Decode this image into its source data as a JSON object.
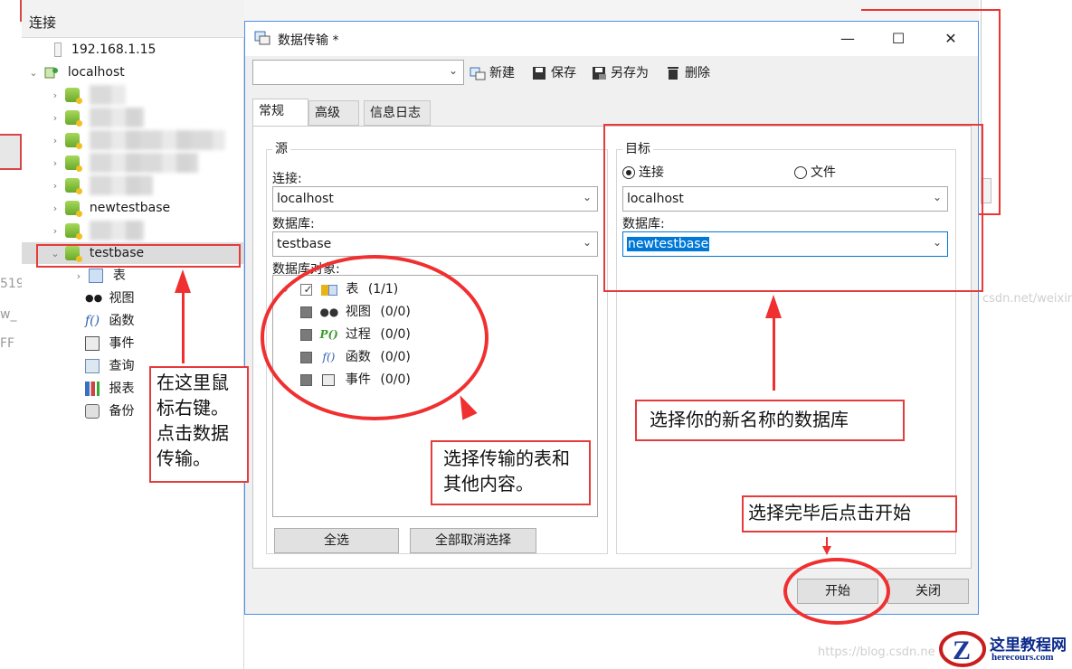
{
  "background": {
    "left_fragments": [
      "519",
      "w_",
      "FF"
    ],
    "watermark_right": "csdn.net/weixin",
    "watermark_bottom": "https://blog.csdn.ne"
  },
  "connection_panel": {
    "header": "连接",
    "tree": {
      "ip_item": "192.168.1.15",
      "localhost": "localhost",
      "newtestbase": "newtestbase",
      "testbase": "testbase",
      "children": [
        "表",
        "视图",
        "函数",
        "事件",
        "查询",
        "报表",
        "备份"
      ]
    }
  },
  "dialog": {
    "title": "数据传输 *",
    "profile_combo_value": "",
    "toolbar": {
      "new": "新建",
      "save": "保存",
      "save_as": "另存为",
      "delete": "删除"
    },
    "tabs": [
      "常规",
      "高级",
      "信息日志"
    ],
    "source": {
      "group_title": "源",
      "connection_label": "连接:",
      "connection_value": "localhost",
      "database_label": "数据库:",
      "database_value": "testbase",
      "objects_label": "数据库对象:",
      "objects": [
        {
          "name": "表",
          "count": "(1/1)"
        },
        {
          "name": "视图",
          "count": "(0/0)"
        },
        {
          "name": "过程",
          "count": "(0/0)"
        },
        {
          "name": "函数",
          "count": "(0/0)"
        },
        {
          "name": "事件",
          "count": "(0/0)"
        }
      ],
      "select_all": "全选",
      "deselect_all": "全部取消选择"
    },
    "target": {
      "group_title": "目标",
      "radio_connection": "连接",
      "radio_file": "文件",
      "connection_value": "localhost",
      "database_label": "数据库:",
      "database_value": "newtestbase"
    },
    "buttons": {
      "start": "开始",
      "close": "关闭"
    }
  },
  "annotations": {
    "right_click_note": "在这里鼠标右键。点击数据传输。",
    "select_tables_note": "选择传输的表和其他内容。",
    "select_db_note": "选择你的新名称的数据库",
    "start_note": "选择完毕后点击开始"
  },
  "logo": {
    "title": "这里教程网",
    "url": "herecours.com"
  },
  "colors": {
    "annotation_red": "#e63b3b",
    "selection_blue": "#0078d7",
    "dialog_border": "#4d8ee8"
  }
}
